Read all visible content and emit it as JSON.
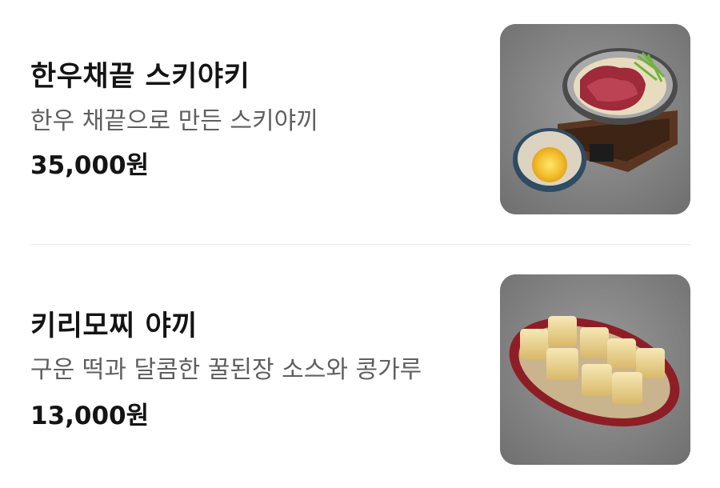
{
  "menu": {
    "items": [
      {
        "name": "한우채끝 스키야키",
        "description": "한우 채끝으로 만든 스키야끼",
        "price": "35,000원",
        "image": "sukiyaki-photo"
      },
      {
        "name": "키리모찌 야끼",
        "description": "구운 떡과 달콤한 꿀된장 소스와 콩가루",
        "price": "13,000원",
        "image": "grilled-mochi-photo"
      }
    ]
  }
}
